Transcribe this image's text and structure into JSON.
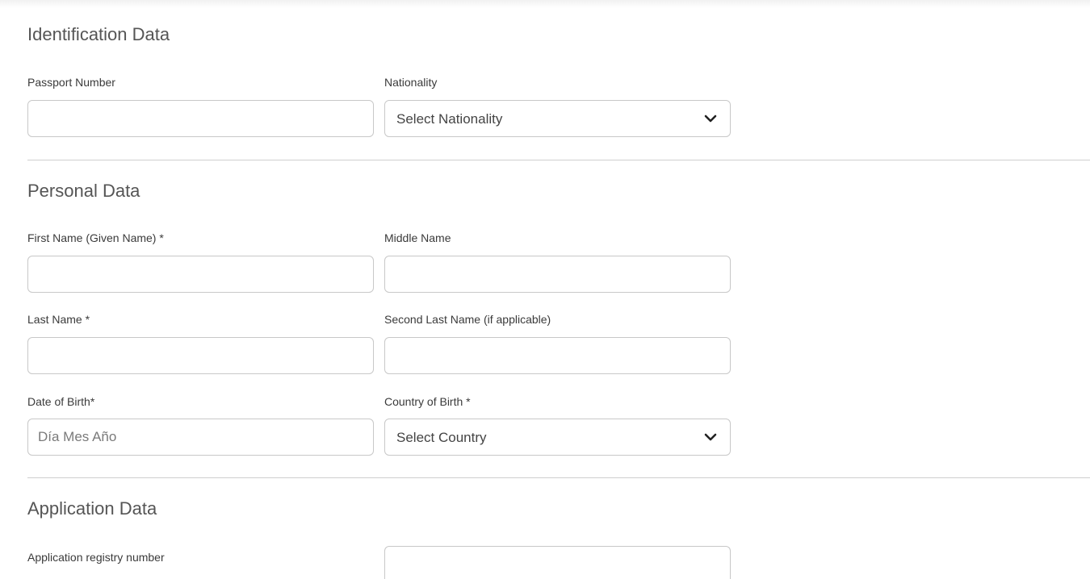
{
  "sections": {
    "identification": {
      "title": "Identification Data",
      "passport_number": {
        "label": "Passport Number",
        "value": "",
        "placeholder": ""
      },
      "nationality": {
        "label": "Nationality",
        "selected": "Select Nationality"
      }
    },
    "personal": {
      "title": "Personal Data",
      "first_name": {
        "label": "First Name (Given Name) *",
        "value": "",
        "placeholder": ""
      },
      "middle_name": {
        "label": "Middle Name",
        "value": "",
        "placeholder": ""
      },
      "last_name": {
        "label": "Last Name *",
        "value": "",
        "placeholder": ""
      },
      "second_last_name": {
        "label": "Second Last Name (if applicable)",
        "value": "",
        "placeholder": ""
      },
      "date_of_birth": {
        "label": "Date of Birth*",
        "value": "",
        "placeholder": "Día Mes Año"
      },
      "country_of_birth": {
        "label": "Country of Birth *",
        "selected": "Select Country"
      }
    },
    "application": {
      "title": "Application Data",
      "registry_number": {
        "label": "Application registry number",
        "value": "",
        "placeholder": ""
      }
    }
  },
  "icons": {
    "dropdown": "chevron-down-icon"
  },
  "colors": {
    "border": "#c8c8c8",
    "divider": "#cfcfcf",
    "title": "#555555",
    "label": "#3a3a3a"
  }
}
